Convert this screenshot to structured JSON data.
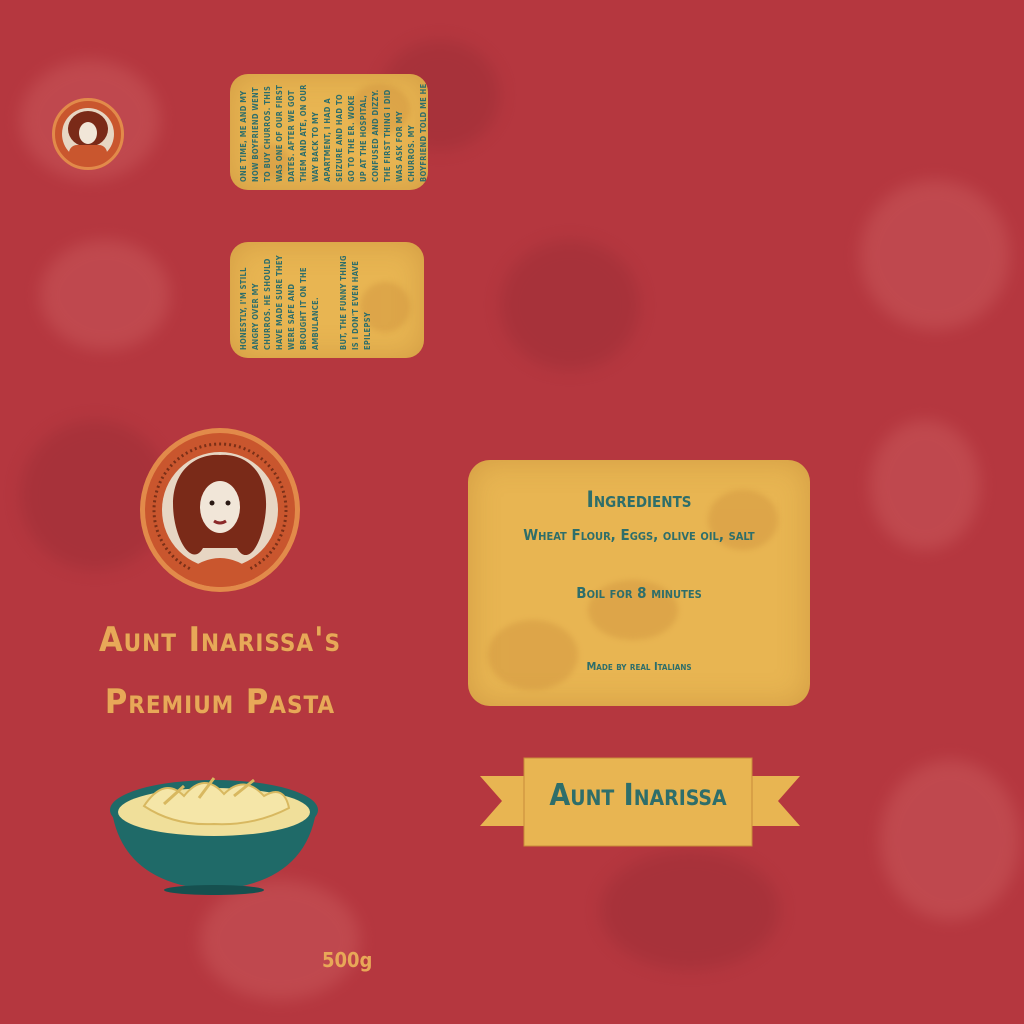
{
  "small_card_1": {
    "text": "One time, me and my now boyfriend went to buy churros. This was one of our first dates. After we got them and ate, on our way back to my apartment, I had a seizure and had to go to the ER. Woke up at the hospital, confused and dizzy. The first thing I did was ask for my churros. My boyfriend told me he had to put them on the ground to 'catch' me so I wouldn't hit my head. I was genuinely sad about that. I fucking love churros."
  },
  "small_card_2": {
    "text": "Honestly, I'm still angry over my churros. He should have made sure they were safe and brought it on the ambulance.",
    "text2": "But, the funny thing is I don't even have epilepsy"
  },
  "brand": {
    "title_line1": "Aunt Inarissa's",
    "title_line2": "Premium Pasta",
    "weight": "500g"
  },
  "info": {
    "heading": "Ingredients",
    "ingredients": "Wheat Flour, Eggs, olive oil, salt",
    "instructions": "Boil for 8 minutes",
    "footer": "Made by real Italians"
  },
  "banner": {
    "text": "Aunt Inarissa"
  },
  "colors": {
    "background": "#b5373f",
    "label": "#e8b552",
    "teal_text": "#2e6e6a",
    "title": "#e8a858",
    "bowl": "#1f6a68"
  }
}
